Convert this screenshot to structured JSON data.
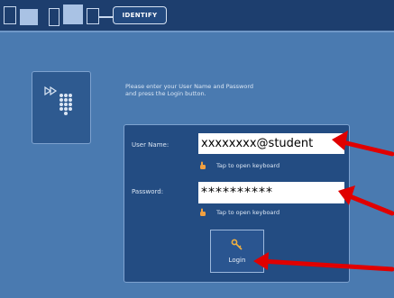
{
  "header": {
    "tab_label": "IDENTIFY"
  },
  "main": {
    "instruction_line1": "Please enter your User Name and Password",
    "instruction_line2": "and press the Login button."
  },
  "form": {
    "username_label": "User Name:",
    "username_value": "xxxxxxxx@student",
    "password_label": "Password:",
    "password_value": "**********",
    "keyboard_hint": "Tap to open keyboard",
    "login_label": "Login"
  },
  "icons": {
    "left_panel": "keypad-icon",
    "hint": "pointing-hand-icon",
    "login": "key-icon",
    "annotation": "red-arrow"
  },
  "colors": {
    "background": "#4a7ab0",
    "topbar": "#1d3e6e",
    "panel": "#234c82",
    "annotation": "#ff0000"
  }
}
